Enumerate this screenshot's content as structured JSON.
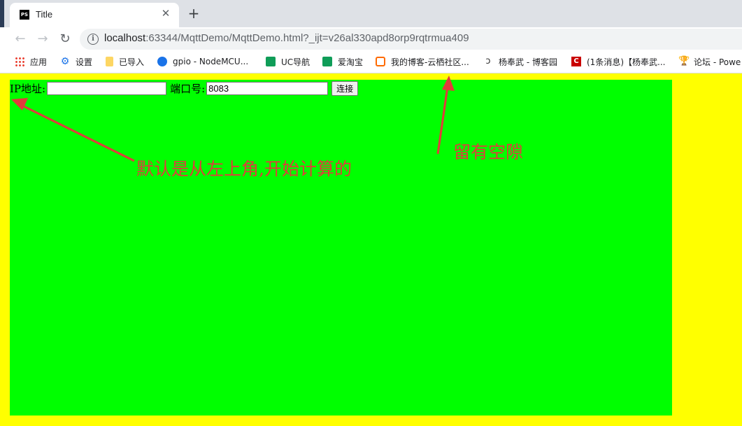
{
  "browser": {
    "tab": {
      "title": "Title",
      "favicon": "PS"
    },
    "address": {
      "host": "localhost",
      "rest": ":63344/MqttDemo/MqttDemo.html?_ijt=v26al330apd8orp9rqtrmua409"
    },
    "bookmarks": [
      {
        "icon": "apps-icon",
        "label": "应用"
      },
      {
        "icon": "gear-icon",
        "label": "设置"
      },
      {
        "icon": "folder-icon",
        "label": "已导入"
      },
      {
        "icon": "globe-icon",
        "label": "gpio - NodeMCU..."
      },
      {
        "icon": "uc-icon",
        "label": "UC导航"
      },
      {
        "icon": "taobao-icon",
        "label": "爱淘宝"
      },
      {
        "icon": "aliyun-icon",
        "label": "我的博客-云栖社区..."
      },
      {
        "icon": "cnblogs-icon",
        "label": "杨奉武 - 博客园"
      },
      {
        "icon": "csdn-icon",
        "label": "(1条消息)【杨奉武..."
      },
      {
        "icon": "trophy-icon",
        "label": "论坛 - Powe"
      }
    ]
  },
  "page": {
    "ip_label": "IP地址:",
    "ip_value": "",
    "port_label": "端口号:",
    "port_value": "8083",
    "connect_label": "连接"
  },
  "annotations": {
    "top_left": "默认是从左上角,开始计算的",
    "gap": "留有空隙"
  },
  "colors": {
    "viewport_bg": "#ffff00",
    "container_bg": "#00ff00",
    "annotation": "#e23b3b"
  }
}
